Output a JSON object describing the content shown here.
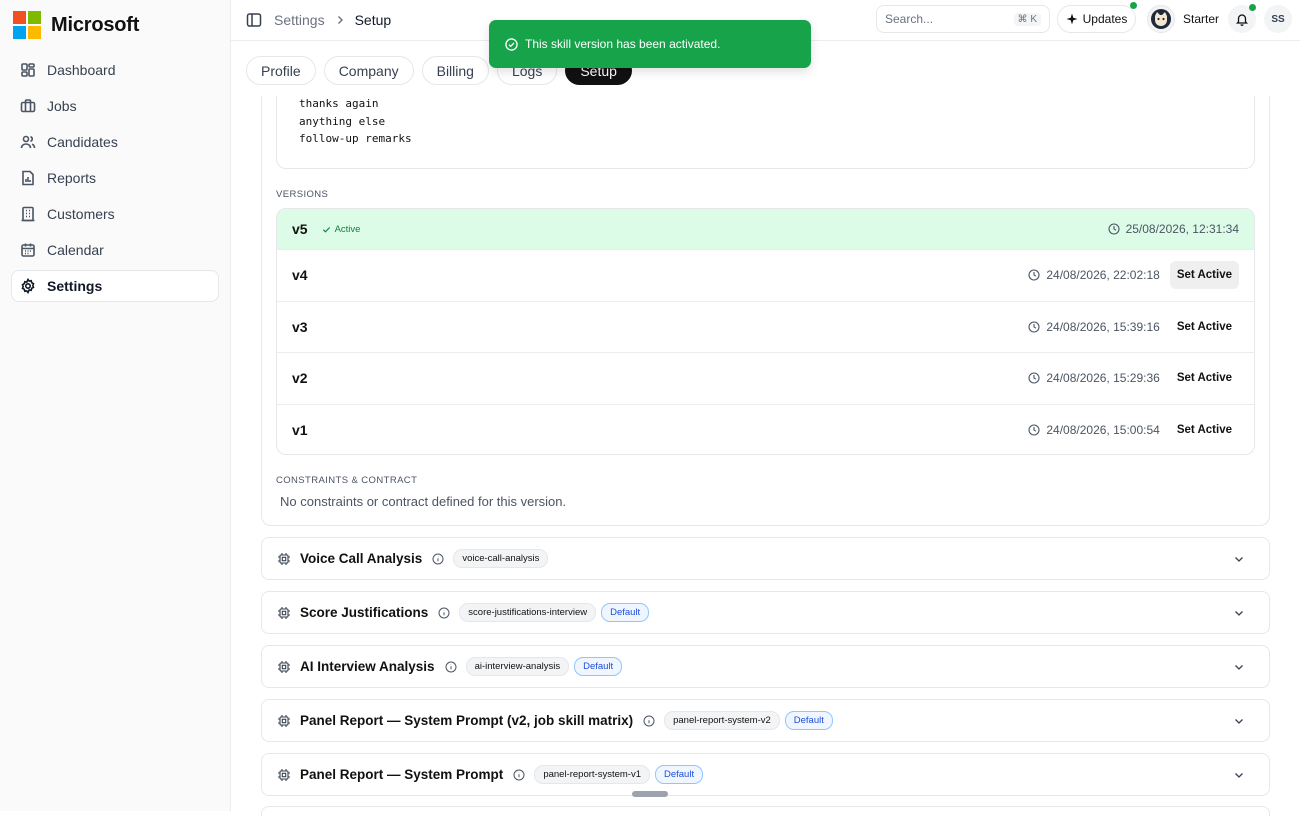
{
  "brand": {
    "name": "Microsoft",
    "logo_colors": [
      "#f25022",
      "#7fba00",
      "#00a4ef",
      "#ffb900"
    ]
  },
  "nav": [
    {
      "label": "Dashboard",
      "icon": "dashboard-icon"
    },
    {
      "label": "Jobs",
      "icon": "briefcase-icon"
    },
    {
      "label": "Candidates",
      "icon": "users-icon"
    },
    {
      "label": "Reports",
      "icon": "report-icon"
    },
    {
      "label": "Customers",
      "icon": "building-icon"
    },
    {
      "label": "Calendar",
      "icon": "calendar-icon"
    },
    {
      "label": "Settings",
      "icon": "gear-icon",
      "active": true
    }
  ],
  "header": {
    "breadcrumb": [
      "Settings",
      "Setup"
    ],
    "search_placeholder": "Search...",
    "search_shortcut": "⌘ K",
    "updates_label": "Updates",
    "plan_label": "Starter",
    "user_initials": "SS"
  },
  "toast": {
    "message": "This skill version has been activated.",
    "color": "#16a34a"
  },
  "tabs": [
    "Profile",
    "Company",
    "Billing",
    "Logs",
    "Setup"
  ],
  "active_tab": "Setup",
  "prompt_lines": [
    "thanks again",
    "anything else",
    "follow-up remarks"
  ],
  "versions_label": "VERSIONS",
  "versions": [
    {
      "name": "v5",
      "status": "Active",
      "date": "25/08/2026, 12:31:34"
    },
    {
      "name": "v4",
      "date": "24/08/2026, 22:02:18",
      "action": "Set Active"
    },
    {
      "name": "v3",
      "date": "24/08/2026, 15:39:16",
      "action": "Set Active"
    },
    {
      "name": "v2",
      "date": "24/08/2026, 15:29:36",
      "action": "Set Active"
    },
    {
      "name": "v1",
      "date": "24/08/2026, 15:00:54",
      "action": "Set Active"
    }
  ],
  "constraints_label": "CONSTRAINTS & CONTRACT",
  "constraints_text": "No constraints or contract defined for this version.",
  "skills": [
    {
      "title": "Voice Call Analysis",
      "slug": "voice-call-analysis"
    },
    {
      "title": "Score Justifications",
      "slug": "score-justifications-interview",
      "badge": "Default"
    },
    {
      "title": "AI Interview Analysis",
      "slug": "ai-interview-analysis",
      "badge": "Default"
    },
    {
      "title": "Panel Report — System Prompt (v2, job skill matrix)",
      "slug": "panel-report-system-v2",
      "badge": "Default"
    },
    {
      "title": "Panel Report — System Prompt",
      "slug": "panel-report-system-v1",
      "badge": "Default"
    }
  ]
}
